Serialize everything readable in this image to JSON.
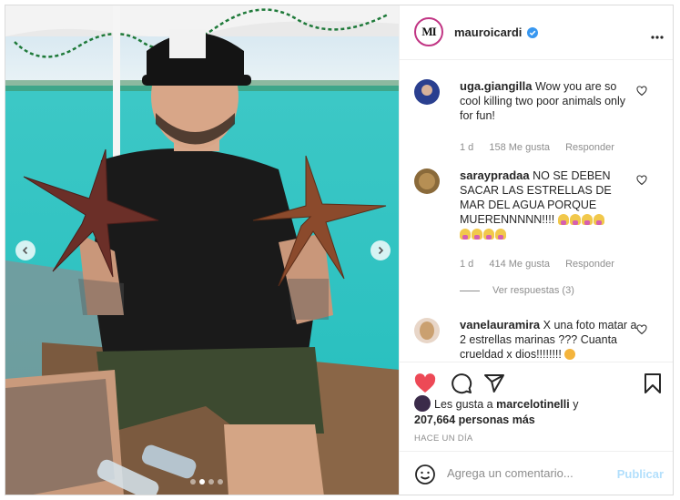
{
  "post": {
    "username": "mauroicardi",
    "verified": true,
    "avatar_letters": "MI",
    "carousel": {
      "dots": 4,
      "active": 1
    }
  },
  "comments": [
    {
      "username": "uga.giangilla",
      "text": "Wow you are so cool killing two poor animals only for fun!",
      "time": "1 d",
      "likes": "158 Me gusta",
      "reply": "Responder"
    },
    {
      "username": "saraypradaa",
      "text": "NO SE DEBEN SACAR LAS ESTRELLAS DE MAR DEL AGUA PORQUE MUERENNNNN!!!!",
      "time": "1 d",
      "likes": "414 Me gusta",
      "reply": "Responder",
      "view_replies": "Ver respuestas (3)"
    },
    {
      "username": "vanelauramira",
      "text": "X una foto matar a 2 estrellas marinas ??? Cuanta crueldad x dios!!!!!!!!"
    }
  ],
  "likes": {
    "prefix": "Les gusta a",
    "user": "marcelotinelli",
    "and": "y",
    "count": "207,664 personas más"
  },
  "time_ago": "HACE UN DÍA",
  "add_comment": {
    "placeholder": "Agrega un comentario...",
    "post": "Publicar"
  },
  "colors": {
    "like_red": "#ed4956",
    "verified_blue": "#3897f0",
    "link_blue": "#b2dffc"
  }
}
